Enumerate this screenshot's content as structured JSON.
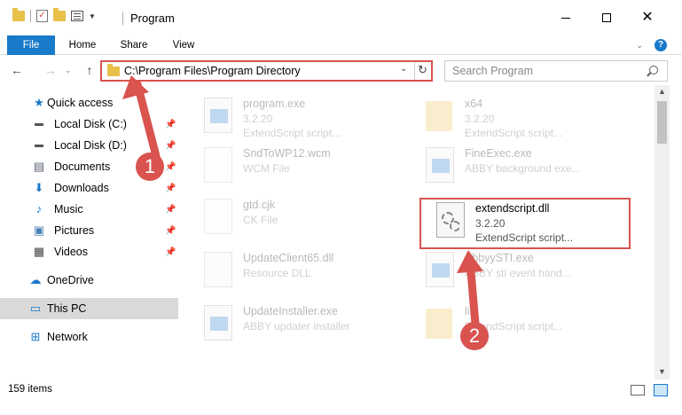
{
  "window": {
    "title": "Program",
    "minimize_label": "–",
    "close_label": "✕"
  },
  "ribbon": {
    "tabs": [
      "File",
      "Home",
      "Share",
      "View"
    ]
  },
  "navbar": {
    "back_glyph": "←",
    "forward_glyph": "→",
    "up_glyph": "↑",
    "address": "C:\\Program Files\\Program Directory",
    "refresh_glyph": "↻",
    "search_placeholder": "Search Program"
  },
  "sidebar": {
    "items": [
      {
        "label": "Quick access",
        "icon": "star-icon",
        "glyph": "★",
        "color": "#1979ca",
        "pinned": false
      },
      {
        "label": "Local Disk (C:)",
        "icon": "drive-icon",
        "glyph": "▬",
        "color": "#555555",
        "pinned": true
      },
      {
        "label": "Local Disk (D:)",
        "icon": "drive-icon",
        "glyph": "▬",
        "color": "#555555",
        "pinned": true
      },
      {
        "label": "Documents",
        "icon": "documents-icon",
        "glyph": "▤",
        "color": "#556070",
        "pinned": true
      },
      {
        "label": "Downloads",
        "icon": "downloads-icon",
        "glyph": "⬇",
        "color": "#1979ca",
        "pinned": true
      },
      {
        "label": "Music",
        "icon": "music-icon",
        "glyph": "♪",
        "color": "#1979ca",
        "pinned": true
      },
      {
        "label": "Pictures",
        "icon": "pictures-icon",
        "glyph": "▣",
        "color": "#4a7fb5",
        "pinned": true
      },
      {
        "label": "Videos",
        "icon": "videos-icon",
        "glyph": "▦",
        "color": "#444444",
        "pinned": true
      },
      {
        "label": "OneDrive",
        "icon": "onedrive-icon",
        "glyph": "☁",
        "color": "#1979ca",
        "pinned": false
      },
      {
        "label": "This PC",
        "icon": "computer-icon",
        "glyph": "▭",
        "color": "#1979ca",
        "pinned": false
      },
      {
        "label": "Network",
        "icon": "network-icon",
        "glyph": "⊞",
        "color": "#1979ca",
        "pinned": false
      }
    ]
  },
  "files": [
    {
      "name": "program.exe",
      "version": "3.2.20",
      "desc": "ExtendScript script...",
      "type": "exe"
    },
    {
      "name": "x64",
      "version": "3.2.20",
      "desc": "ExtendScript script...",
      "type": "folder"
    },
    {
      "name": "SndToWP12.wcm",
      "version": "WCM File",
      "desc": "",
      "type": "file"
    },
    {
      "name": "FineExec.exe",
      "version": "ABBY background exe...",
      "desc": "",
      "type": "exe"
    },
    {
      "name": "gtd.cjk",
      "version": "CK File",
      "desc": "",
      "type": "file"
    },
    {
      "name": "extendscript.dll",
      "version": "3.2.20",
      "desc": "ExtendScript script...",
      "type": "dll"
    },
    {
      "name": "UpdateClient65.dll",
      "version": "Resource DLL",
      "desc": "",
      "type": "dll"
    },
    {
      "name": "AbbyySTI.exe",
      "version": "ABBY sti event hand...",
      "desc": "",
      "type": "exe"
    },
    {
      "name": "UpdateInstaller.exe",
      "version": "ABBY updater installer",
      "desc": "",
      "type": "exe"
    },
    {
      "name": "lib",
      "version": "ExtendScript script...",
      "desc": "",
      "type": "folder"
    }
  ],
  "status": {
    "item_count": "159 items"
  },
  "annotations": {
    "step1": "1",
    "step2": "2",
    "accent_color": "#d9534f"
  }
}
